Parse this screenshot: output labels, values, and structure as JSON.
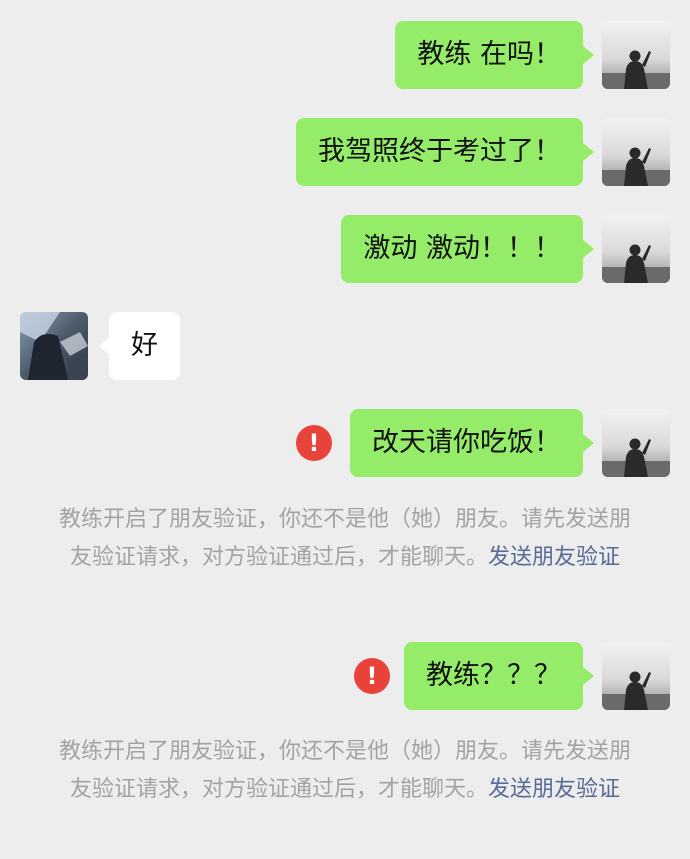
{
  "messages": [
    {
      "side": "me",
      "text": "教练 在吗！",
      "status": "sent"
    },
    {
      "side": "me",
      "text": "我驾照终于考过了！",
      "status": "sent"
    },
    {
      "side": "me",
      "text": "激动 激动！！！",
      "status": "sent"
    },
    {
      "side": "them",
      "text": "好",
      "status": "received"
    },
    {
      "side": "me",
      "text": "改天请你吃饭！",
      "status": "failed"
    },
    {
      "side": "me",
      "text": "教练？？？",
      "status": "failed"
    }
  ],
  "notices": [
    {
      "text": "教练开启了朋友验证，你还不是他（她）朋友。请先发送朋友验证请求，对方验证通过后，才能聊天。",
      "link": "发送朋友验证"
    },
    {
      "text": "教练开启了朋友验证，你还不是他（她）朋友。请先发送朋友验证请求，对方验证通过后，才能聊天。",
      "link": "发送朋友验证"
    }
  ],
  "icons": {
    "failed": "exclamation-icon",
    "me_avatar": "silhouette-avatar",
    "them_avatar": "photo-avatar"
  },
  "colors": {
    "background": "#ededed",
    "me_bubble": "#95ec69",
    "them_bubble": "#ffffff",
    "error": "#e8433a",
    "link": "#576b95",
    "notice_text": "#a3a3a3"
  }
}
